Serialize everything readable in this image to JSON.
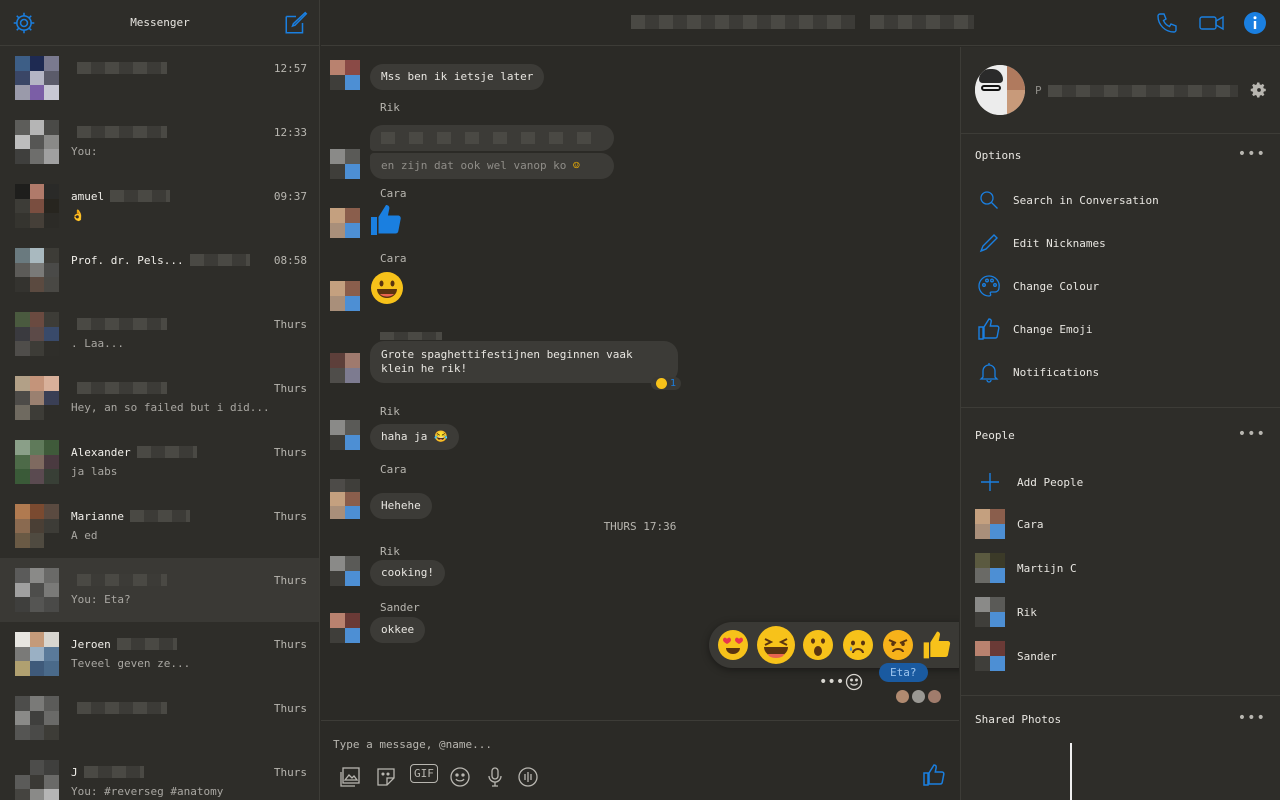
{
  "colors": {
    "accent": "#1a7fe0",
    "bg": "#2b2a26",
    "bubble": "#3c3b37"
  },
  "sidebar": {
    "title": "Messenger",
    "conversations": [
      {
        "name": "",
        "snippet": "",
        "time": "12:57"
      },
      {
        "name": "",
        "snippet": "You:",
        "time": "12:33"
      },
      {
        "name": "amuel",
        "snippet": "👌",
        "time": "09:37"
      },
      {
        "name": "Prof. dr.                Pels...",
        "snippet": "",
        "time": "08:58"
      },
      {
        "name": "",
        "snippet": "                          . Laa...",
        "time": "Thurs"
      },
      {
        "name": "",
        "snippet": "Hey,  an  so       failed but i did...",
        "time": "Thurs"
      },
      {
        "name": "Alexander",
        "snippet": "ja labs",
        "time": "Thurs"
      },
      {
        "name": "Marianne",
        "snippet": "A                           ed",
        "time": "Thurs"
      },
      {
        "name": "",
        "snippet": "You: Eta?",
        "time": "Thurs"
      },
      {
        "name": "Jeroen",
        "snippet": "Teveel                  geven ze...",
        "time": "Thurs"
      },
      {
        "name": "",
        "snippet": "",
        "time": "Thurs"
      },
      {
        "name": "J",
        "snippet": "You: #reverseg #anatomy",
        "time": "Thurs"
      }
    ]
  },
  "chat": {
    "messages": [
      {
        "sender": "",
        "text": "Mss ben ik ietsje later"
      },
      {
        "sender": "Rik",
        "text": ""
      },
      {
        "sender": "",
        "text": "en zijn dat ook wel vanop ko"
      },
      {
        "sender": "Cara",
        "text": ""
      },
      {
        "sender": "Cara",
        "text": ""
      },
      {
        "sender": "",
        "text": "Grote spaghettifestijnen beginnen vaak klein he rik!"
      },
      {
        "sender": "Rik",
        "text": "haha ja 😂"
      },
      {
        "sender": "Cara",
        "text": "Hehehe"
      },
      {
        "sender": "Rik",
        "text": "cooking!"
      },
      {
        "sender": "Sander",
        "text": "okkee"
      }
    ],
    "reaction_count": "1",
    "day_separator": "THURS 17:36",
    "my_message": "Eta?",
    "composer_placeholder": "Type a message, @name...",
    "composer_tools": [
      "image-icon",
      "sticker-icon",
      "gif-icon",
      "emoji-icon",
      "mic-icon",
      "audio-icon"
    ],
    "gif_label": "GIF",
    "reactions": [
      "love-eyes",
      "laugh",
      "wow",
      "sad",
      "angry",
      "thumbs-up",
      "thumbs-down"
    ]
  },
  "info": {
    "profile_name": "P",
    "sections": {
      "options": "Options",
      "people": "People",
      "shared_photos": "Shared Photos"
    },
    "more": "•••",
    "options": [
      {
        "label": "Search in Conversation",
        "icon": "search-icon"
      },
      {
        "label": "Edit Nicknames",
        "icon": "pencil-icon"
      },
      {
        "label": "Change Colour",
        "icon": "palette-icon"
      },
      {
        "label": "Change Emoji",
        "icon": "thumbs-up-icon"
      },
      {
        "label": "Notifications",
        "icon": "bell-icon"
      }
    ],
    "add_people": "Add People",
    "people": [
      {
        "name": "Cara"
      },
      {
        "name": "Martijn C"
      },
      {
        "name": "Rik"
      },
      {
        "name": "Sander"
      }
    ]
  }
}
